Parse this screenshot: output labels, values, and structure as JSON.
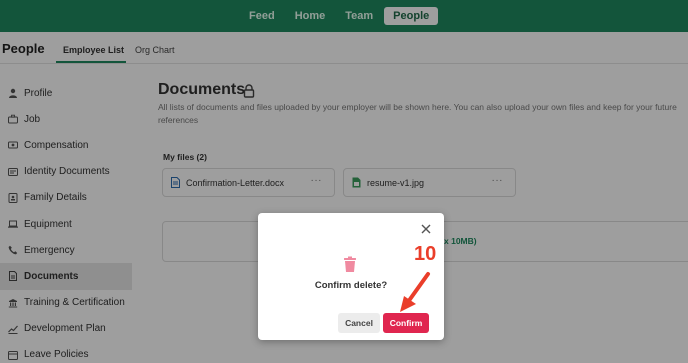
{
  "topnav": {
    "items": [
      "Feed",
      "Home",
      "Team",
      "People"
    ],
    "active_index": 3
  },
  "page": {
    "title": "People",
    "tabs": [
      "Employee List",
      "Org Chart"
    ]
  },
  "sidebar": {
    "items": [
      {
        "label": "Profile",
        "icon": "person-icon"
      },
      {
        "label": "Job",
        "icon": "briefcase-icon"
      },
      {
        "label": "Compensation",
        "icon": "money-icon"
      },
      {
        "label": "Identity Documents",
        "icon": "id-card-icon"
      },
      {
        "label": "Family Details",
        "icon": "family-icon"
      },
      {
        "label": "Equipment",
        "icon": "laptop-icon"
      },
      {
        "label": "Emergency",
        "icon": "phone-icon"
      },
      {
        "label": "Documents",
        "icon": "document-icon"
      },
      {
        "label": "Training & Certification",
        "icon": "certificate-icon"
      },
      {
        "label": "Development Plan",
        "icon": "chart-icon"
      },
      {
        "label": "Leave Policies",
        "icon": "calendar-icon"
      }
    ],
    "active_index": 7
  },
  "main": {
    "title": "Documents",
    "description": "All lists of documents and files uploaded by your employer will be shown here. You can also upload your own files and keep for your future references",
    "my_files_label": "My files (2)",
    "files": [
      {
        "name": "Confirmation-Letter.docx",
        "icon": "word-file-icon",
        "more": "···"
      },
      {
        "name": "resume-v1.jpg",
        "icon": "image-file-icon",
        "more": "···"
      }
    ],
    "upload_hint": "x 10MB)"
  },
  "modal": {
    "message": "Confirm delete?",
    "cancel_label": "Cancel",
    "confirm_label": "Confirm",
    "close_icon": "close-icon",
    "icon": "trash-icon"
  },
  "annotation": {
    "step_number": "10"
  },
  "colors": {
    "brand": "#1f8a5f",
    "danger": "#e0264f",
    "annotation": "#ea3e2a"
  }
}
